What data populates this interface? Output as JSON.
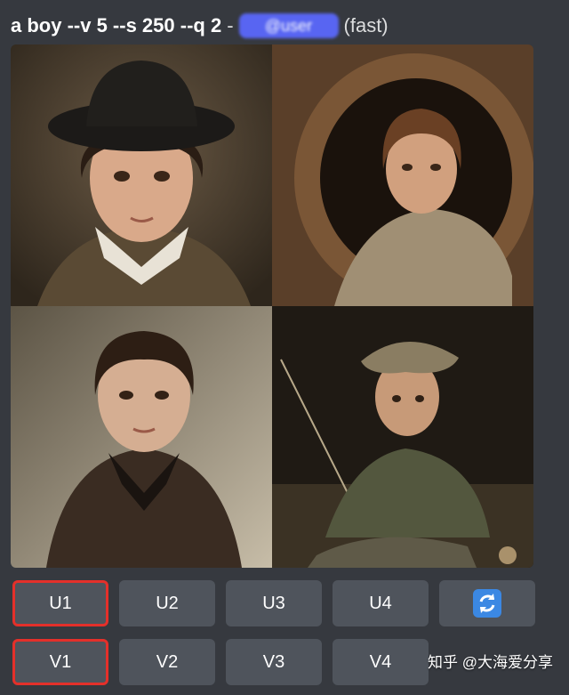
{
  "message": {
    "prompt": "a boy --v 5 --s 250 --q 2",
    "separator": "-",
    "mention": "@user",
    "speed": "(fast)"
  },
  "upscale_buttons": [
    "U1",
    "U2",
    "U3",
    "U4"
  ],
  "variation_buttons": [
    "V1",
    "V2",
    "V3",
    "V4"
  ],
  "reroll_icon": "refresh-icon",
  "watermark": "知乎 @大海爱分享",
  "colors": {
    "background": "#36393f",
    "button": "#4f545c",
    "highlight_border": "#e4302a",
    "reroll_blue": "#3b88e3"
  }
}
